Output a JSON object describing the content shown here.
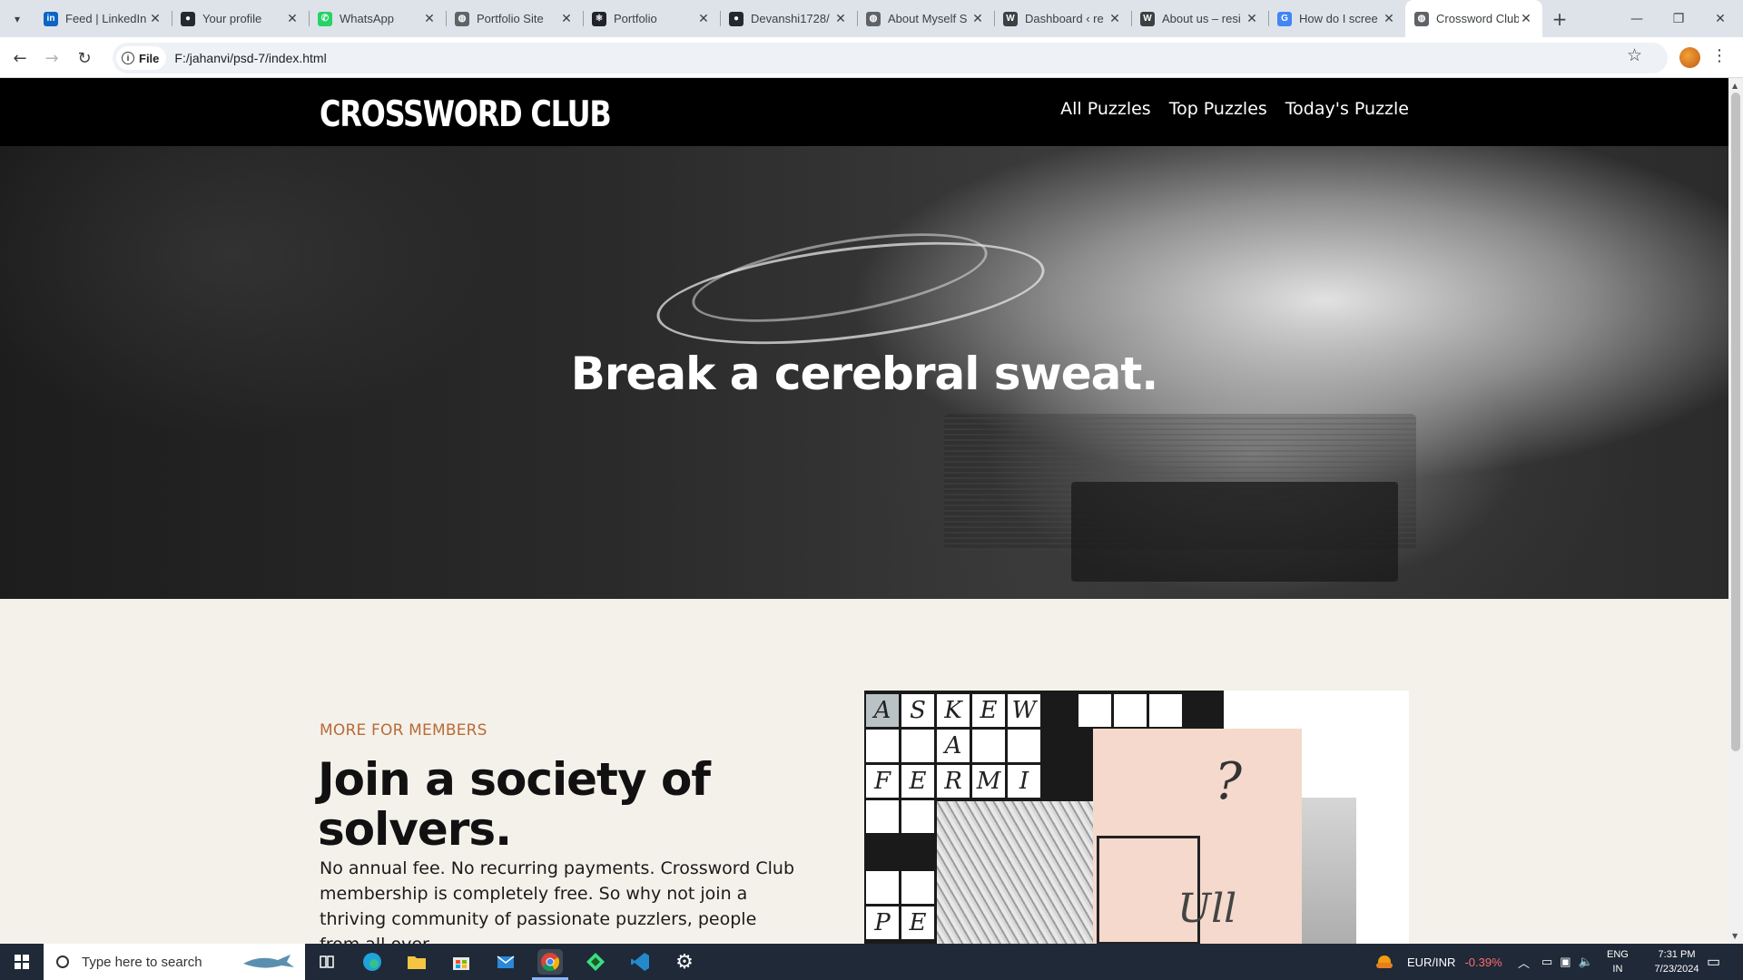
{
  "browser": {
    "tabs": [
      {
        "title": "Feed | LinkedIn",
        "favicon": "linkedin-icon",
        "color": "#0a66c2"
      },
      {
        "title": "Your profile",
        "favicon": "github-icon",
        "color": "#24292f"
      },
      {
        "title": "WhatsApp",
        "favicon": "whatsapp-icon",
        "color": "#25d366"
      },
      {
        "title": "Portfolio Site",
        "favicon": "globe-icon",
        "color": "#5f6368"
      },
      {
        "title": "Portfolio",
        "favicon": "react-icon",
        "color": "#20232a"
      },
      {
        "title": "Devanshi1728/",
        "favicon": "github-icon",
        "color": "#24292f"
      },
      {
        "title": "About Myself S",
        "favicon": "globe-icon",
        "color": "#5f6368"
      },
      {
        "title": "Dashboard ‹ re",
        "favicon": "wordpress-icon",
        "color": "#3c4043"
      },
      {
        "title": "About us – resi",
        "favicon": "wordpress-icon",
        "color": "#3c4043"
      },
      {
        "title": "How do I scree",
        "favicon": "google-icon",
        "color": "#4285f4"
      },
      {
        "title": "Crossword Club",
        "favicon": "globe-icon",
        "color": "#5f6368",
        "active": true
      }
    ],
    "address_chip": "File",
    "url": "F:/jahanvi/psd-7/index.html"
  },
  "site": {
    "logo": "CROSSWORD CLUB",
    "nav": [
      "All Puzzles",
      "Top Puzzles",
      "Today's Puzzle"
    ],
    "hero_title": "Break a cerebral sweat.",
    "eyebrow": "MORE FOR MEMBERS",
    "join_title": "Join a society of solvers.",
    "join_body": "No annual fee. No recurring payments. Crossword Club membership is completely free. So why not join a thriving community of passionate puzzlers, people from all over",
    "crossword_letters": [
      "A",
      "S",
      "K",
      "E",
      "W",
      "A",
      "F",
      "E",
      "R",
      "M",
      "I",
      "P",
      "E"
    ],
    "collage_question": "?",
    "collage_scribble": "Ull"
  },
  "taskbar": {
    "search_placeholder": "Type here to search",
    "currency_label": "EUR/INR",
    "currency_change": "-0.39%",
    "language_top": "ENG",
    "language_bottom": "IN",
    "time": "7:31 PM",
    "date": "7/23/2024"
  },
  "colors": {
    "accent_eyebrow": "#b86b3a",
    "header_bg": "#000000",
    "page_bg": "#f4f1ea",
    "collage_pink": "#f5d9cd",
    "negative_change": "#ff6b6b"
  }
}
